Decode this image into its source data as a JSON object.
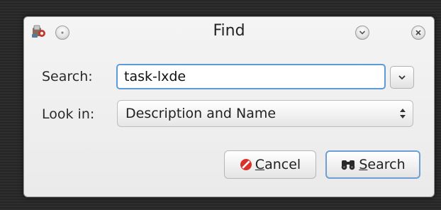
{
  "window": {
    "title": "Find",
    "icons": {
      "app": "app-icon",
      "menu": "circle-menu-icon",
      "minimize": "chevron-down-icon",
      "close": "close-icon"
    }
  },
  "search": {
    "label": "Search:",
    "value": "task-lxde",
    "history_icon": "chevron-down-icon"
  },
  "look_in": {
    "label": "Look in:",
    "selected": "Description and Name",
    "icon": "up-down-arrows-icon"
  },
  "buttons": {
    "cancel": {
      "mnemonic": "C",
      "rest": "ancel",
      "icon": "cancel-icon"
    },
    "search": {
      "mnemonic": "S",
      "rest": "earch",
      "icon": "binoculars-icon"
    }
  },
  "colors": {
    "focus_border": "#5e9ad8",
    "cancel_icon": "#d8322b",
    "default_button_border": "#6e9fd4"
  }
}
